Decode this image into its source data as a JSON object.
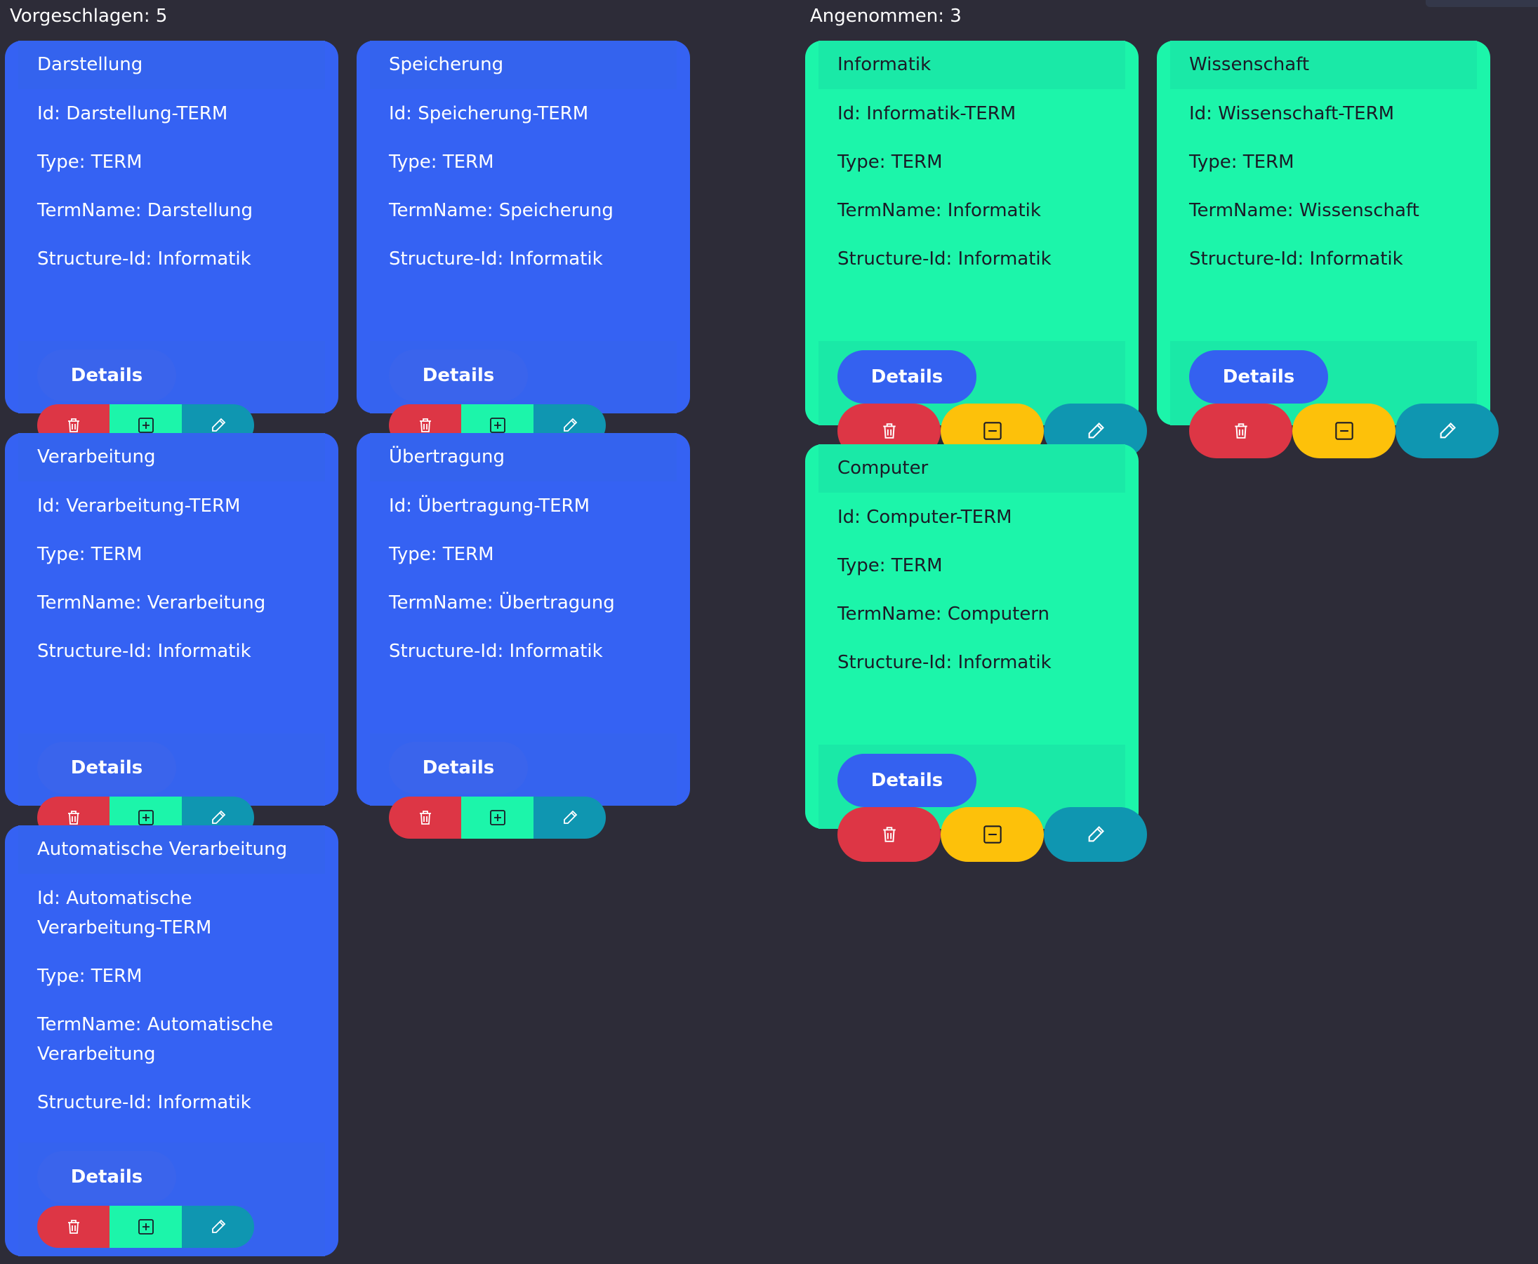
{
  "proposed": {
    "title": "Vorgeschlagen: 5",
    "cards": [
      {
        "header": "Darstellung",
        "id": "Id: Darstellung-TERM",
        "type": "Type: TERM",
        "term": "TermName: Darstellung",
        "structure": "Structure-Id: Informatik",
        "details": "Details"
      },
      {
        "header": "Speicherung",
        "id": "Id: Speicherung-TERM",
        "type": "Type: TERM",
        "term": "TermName: Speicherung",
        "structure": "Structure-Id: Informatik",
        "details": "Details"
      },
      {
        "header": "Verarbeitung",
        "id": "Id: Verarbeitung-TERM",
        "type": "Type: TERM",
        "term": "TermName: Verarbeitung",
        "structure": "Structure-Id: Informatik",
        "details": "Details"
      },
      {
        "header": "Übertragung",
        "id": "Id: Übertragung-TERM",
        "type": "Type: TERM",
        "term": "TermName: Übertragung",
        "structure": "Structure-Id: Informatik",
        "details": "Details"
      },
      {
        "header": "Automatische Verarbeitung",
        "id": "Id: Automatische Verarbeitung-TERM",
        "type": "Type: TERM",
        "term": "TermName: Automatische Verarbeitung",
        "structure": "Structure-Id: Informatik",
        "details": "Details"
      }
    ]
  },
  "accepted": {
    "title": "Angenommen: 3",
    "cards": [
      {
        "header": "Informatik",
        "id": "Id: Informatik-TERM",
        "type": "Type: TERM",
        "term": "TermName: Informatik",
        "structure": "Structure-Id: Informatik",
        "details": "Details"
      },
      {
        "header": "Wissenschaft",
        "id": "Id: Wissenschaft-TERM",
        "type": "Type: TERM",
        "term": "TermName: Wissenschaft",
        "structure": "Structure-Id: Informatik",
        "details": "Details"
      },
      {
        "header": "Computer",
        "id": "Id: Computer-TERM",
        "type": "Type: TERM",
        "term": "TermName: Computern",
        "structure": "Structure-Id: Informatik",
        "details": "Details"
      }
    ]
  },
  "icons": {
    "delete": "trash-icon",
    "accept": "plus-square-icon",
    "reject": "minus-square-icon",
    "edit": "pencil-icon"
  },
  "colors": {
    "background": "#2d2c38",
    "proposed_card": "#3562f3",
    "accepted_card": "#1cf5aa",
    "delete": "#dd3645",
    "accept": "#1cf5aa",
    "reject": "#fdc10a",
    "edit": "#0f96b1"
  }
}
